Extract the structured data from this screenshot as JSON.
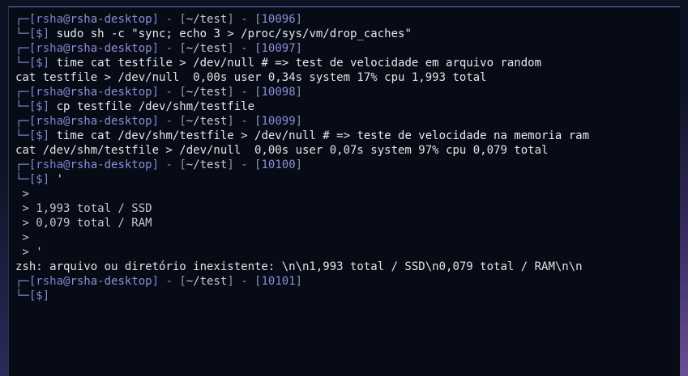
{
  "terminal": {
    "user": "rsha",
    "host": "rsha-desktop",
    "path": "~/test",
    "blocks": [
      {
        "num": "10096",
        "cmd": "sudo sh -c \"sync; echo 3 > /proc/sys/vm/drop_caches\""
      },
      {
        "num": "10097",
        "cmd": "time cat testfile > /dev/null # => test de velocidade em arquivo random",
        "output": [
          "cat testfile > /dev/null  0,00s user 0,34s system 17% cpu 1,993 total"
        ]
      },
      {
        "num": "10098",
        "cmd": "cp testfile /dev/shm/testfile"
      },
      {
        "num": "10099",
        "cmd": "time cat /dev/shm/testfile > /dev/null # => teste de velocidade na memoria ram",
        "output": [
          "cat /dev/shm/testfile > /dev/null  0,00s user 0,07s system 97% cpu 0,079 total"
        ]
      },
      {
        "num": "10100",
        "cmd": "'",
        "continuation": [
          ">",
          "> 1,993 total / SSD",
          "> 0,079 total / RAM",
          ">",
          "> '"
        ],
        "output": [
          "zsh: arquivo ou diretório inexistente: \\n\\n1,993 total / SSD\\n0,079 total / RAM\\n\\n"
        ]
      },
      {
        "num": "10101",
        "cmd": ""
      }
    ]
  }
}
